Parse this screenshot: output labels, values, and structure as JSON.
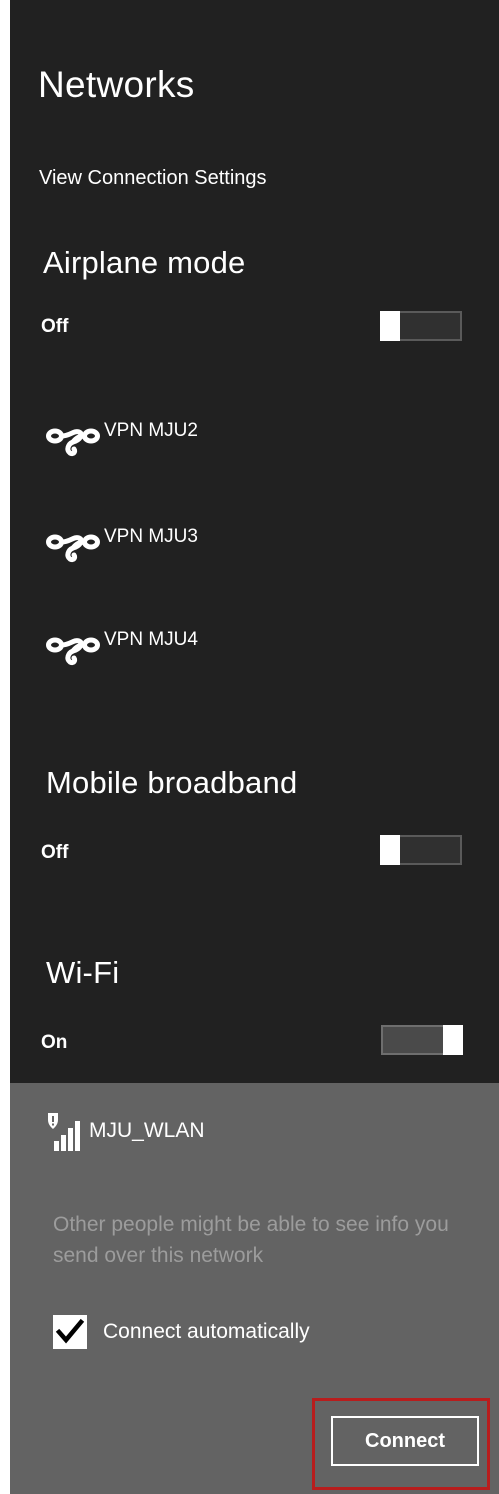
{
  "header": {
    "title": "Networks",
    "view_settings_link": "View Connection Settings"
  },
  "airplane_mode": {
    "label": "Airplane mode",
    "state": "Off"
  },
  "vpns": [
    {
      "label": "VPN MJU2",
      "icon": "vpn-icon"
    },
    {
      "label": "VPN MJU3",
      "icon": "vpn-icon"
    },
    {
      "label": "VPN MJU4",
      "icon": "vpn-icon"
    }
  ],
  "mobile_broadband": {
    "label": "Mobile broadband",
    "state": "Off"
  },
  "wifi": {
    "label": "Wi-Fi",
    "state": "On"
  },
  "selected_network": {
    "ssid": "MJU_WLAN",
    "icon": "wifi-signal-unsecured-icon",
    "warning": "Other people might be able to see info you send over this network",
    "connect_automatically_label": "Connect automatically",
    "connect_automatically_checked": true,
    "connect_button": "Connect"
  },
  "colors": {
    "pane_background": "#212121",
    "selected_network_background": "#636363",
    "highlight_border": "#b81d1d"
  }
}
